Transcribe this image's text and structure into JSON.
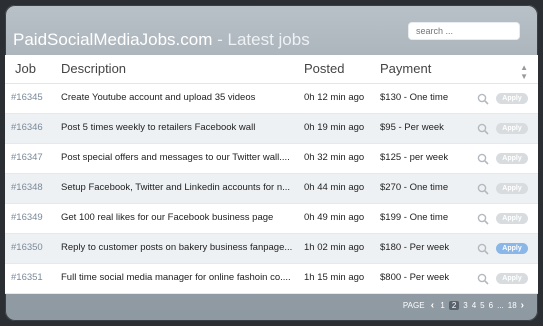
{
  "header": {
    "site_name": "PaidSocialMediaJobs.com",
    "section": " - Latest jobs",
    "search_placeholder": "search ..."
  },
  "columns": {
    "job": "Job",
    "description": "Description",
    "posted": "Posted",
    "payment": "Payment"
  },
  "rows": [
    {
      "id": "#16345",
      "desc": "Create Youtube account and upload 35 videos",
      "posted": "0h 12 min ago",
      "pay": "$130 - One time",
      "apply": "Apply"
    },
    {
      "id": "#16346",
      "desc": "Post 5 times weekly to retailers Facebook wall",
      "posted": "0h 19 min ago",
      "pay": "$95   - Per week",
      "apply": "Apply"
    },
    {
      "id": "#16347",
      "desc": "Post special offers and messages to our Twitter wall....",
      "posted": "0h 32 min ago",
      "pay": "$125 - per week",
      "apply": "Apply"
    },
    {
      "id": "#16348",
      "desc": "Setup Facebook, Twitter and Linkedin accounts for n...",
      "posted": "0h 44 min ago",
      "pay": "$270 - One time",
      "apply": "Apply"
    },
    {
      "id": "#16349",
      "desc": "Get 100 real likes for our Facebook business page",
      "posted": "0h 49 min ago",
      "pay": "$199 - One time",
      "apply": "Apply"
    },
    {
      "id": "#16350",
      "desc": "Reply to customer posts on bakery business fanpage...",
      "posted": "1h 02 min ago",
      "pay": "$180 - Per week",
      "apply": "Apply"
    },
    {
      "id": "#16351",
      "desc": "Full time social media manager for online fashoin co....",
      "posted": "1h 15 min ago",
      "pay": "$800 - Per week",
      "apply": "Apply"
    }
  ],
  "pager": {
    "label": "PAGE",
    "prev": "‹",
    "pages": [
      "1",
      "2",
      "3",
      "4",
      "5",
      "6",
      "...",
      "18"
    ],
    "current": "2",
    "next": "›"
  },
  "colors": {
    "apply_active": "#8ab6e8",
    "apply_inactive": "#d8dcdf",
    "id_text": "#7a8a99"
  },
  "icons": [
    "search-icon",
    "sort-icon",
    "chevron-left-icon",
    "chevron-right-icon"
  ]
}
